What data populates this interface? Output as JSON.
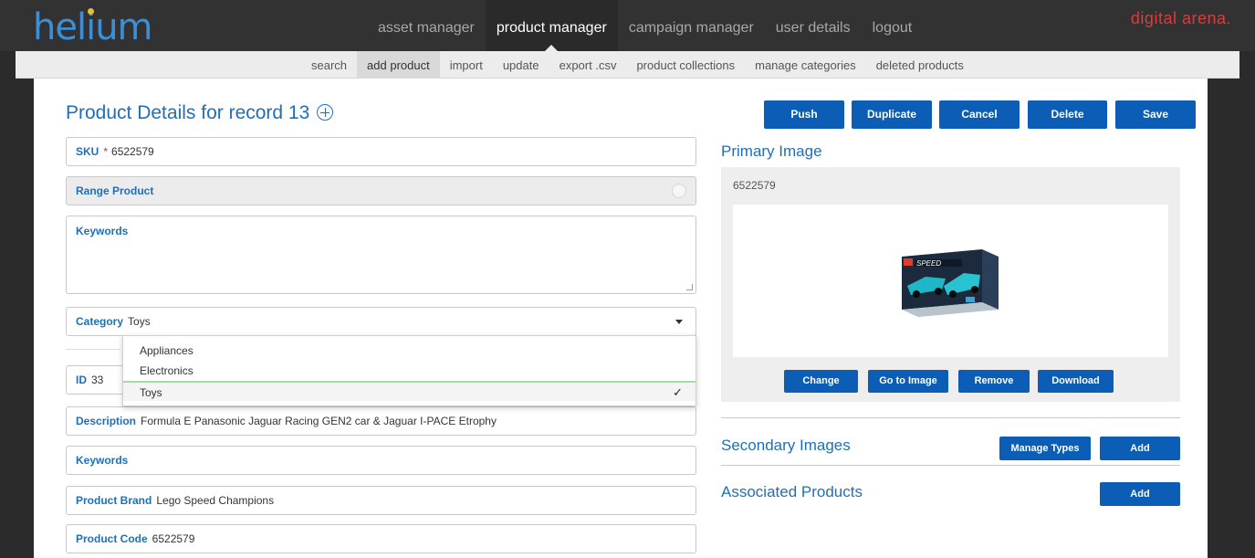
{
  "header": {
    "logo": "helium",
    "nav": [
      {
        "label": "asset manager",
        "active": false
      },
      {
        "label": "product manager",
        "active": true
      },
      {
        "label": "campaign manager",
        "active": false
      },
      {
        "label": "user details",
        "active": false
      },
      {
        "label": "logout",
        "active": false
      }
    ],
    "brand": "digital arena."
  },
  "subnav": [
    {
      "label": "search",
      "active": false
    },
    {
      "label": "add product",
      "active": true
    },
    {
      "label": "import",
      "active": false
    },
    {
      "label": "update",
      "active": false
    },
    {
      "label": "export .csv",
      "active": false
    },
    {
      "label": "product collections",
      "active": false
    },
    {
      "label": "manage categories",
      "active": false
    },
    {
      "label": "deleted products",
      "active": false
    }
  ],
  "page": {
    "title": "Product Details for record 13"
  },
  "actions": {
    "push": "Push",
    "duplicate": "Duplicate",
    "cancel": "Cancel",
    "delete": "Delete",
    "save": "Save"
  },
  "form": {
    "sku": {
      "label": "SKU",
      "required_mark": "*",
      "value": "6522579"
    },
    "range_product": {
      "label": "Range Product"
    },
    "keywords_top": {
      "label": "Keywords",
      "value": ""
    },
    "category": {
      "label": "Category",
      "value": "Toys",
      "options": [
        "Appliances",
        "Electronics",
        "Toys"
      ],
      "selected": "Toys"
    },
    "id": {
      "label": "ID",
      "value": "33"
    },
    "description": {
      "label": "Description",
      "value": "Formula E Panasonic Jaguar Racing GEN2 car & Jaguar I-PACE Etrophy"
    },
    "keywords": {
      "label": "Keywords",
      "value": ""
    },
    "product_brand": {
      "label": "Product Brand",
      "value": "Lego Speed Champions"
    },
    "product_code": {
      "label": "Product Code",
      "value": "6522579"
    }
  },
  "primary_image": {
    "title": "Primary Image",
    "id": "6522579",
    "buttons": {
      "change": "Change",
      "go_to_image": "Go to Image",
      "remove": "Remove",
      "download": "Download"
    },
    "box_text": "SPEED"
  },
  "secondary_images": {
    "title": "Secondary Images",
    "manage_types": "Manage Types",
    "add": "Add"
  },
  "associated_products": {
    "title": "Associated Products",
    "add": "Add"
  },
  "colors": {
    "accent": "#1f6fb8",
    "button": "#0b5db5",
    "brand": "#d93c3c",
    "logo": "#3c8fd6"
  }
}
